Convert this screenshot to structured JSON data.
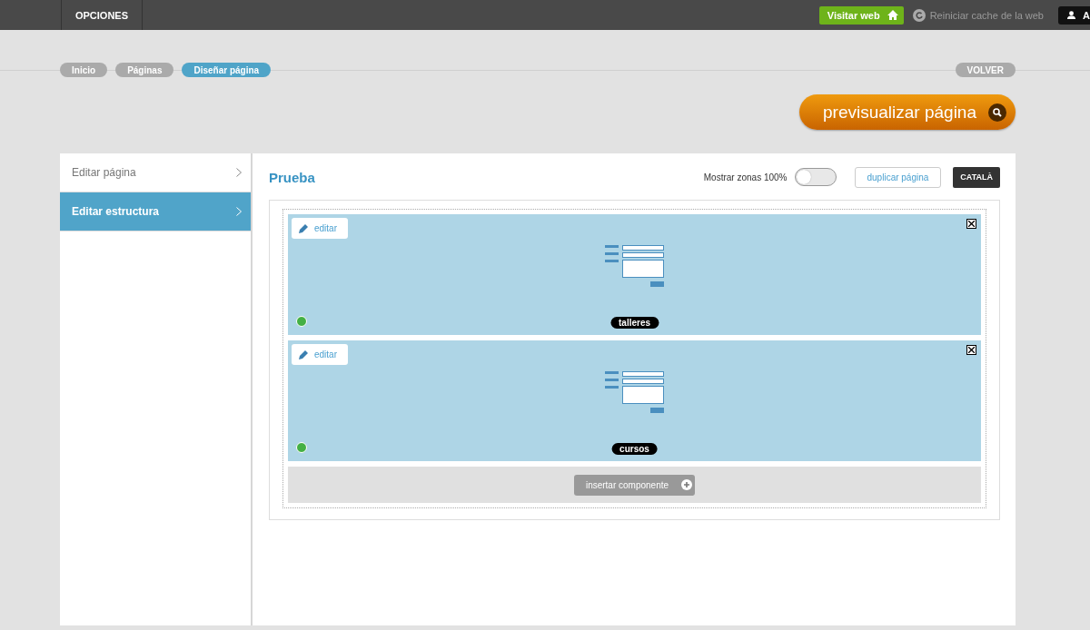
{
  "topbar": {
    "menu": "OPCIONES",
    "visit": "Visitar web",
    "cache": "Reiniciar cache de la web",
    "user": "A"
  },
  "breadcrumbs": [
    {
      "label": "Inicio",
      "selected": false
    },
    {
      "label": "Páginas",
      "selected": false
    },
    {
      "label": "Diseñar página",
      "selected": true
    }
  ],
  "back": "VOLVER",
  "preview": "previsualizar página",
  "sidebar": {
    "items": [
      {
        "label": "Editar página",
        "selected": false
      },
      {
        "label": "Editar estructura",
        "selected": true
      }
    ]
  },
  "page": {
    "title": "Prueba",
    "zones_label": "Mostrar zonas 100%",
    "zones_on": false,
    "duplicate": "duplicar página",
    "language": "CATALÀ"
  },
  "components": [
    {
      "edit": "editar",
      "label": "talleres",
      "color": "#44b044"
    },
    {
      "edit": "editar",
      "label": "cursos",
      "color": "#44b044"
    }
  ],
  "insert": "insertar componente"
}
